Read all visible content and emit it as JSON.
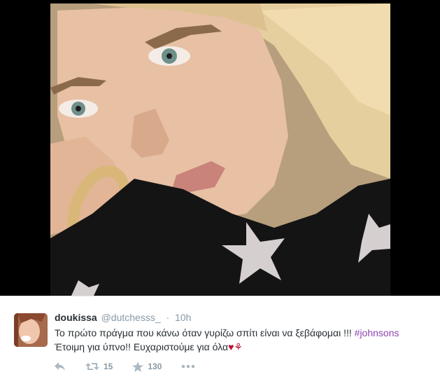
{
  "tweet": {
    "fullname": "doukissa",
    "username": "@dutchesss_",
    "separator": "·",
    "time": "10h",
    "text_line1": "Το πρώτο πράγμα που κάνω όταν γυρίζω σπίτι είναι να ξεβάφομαι !!! ",
    "hashtag": "#johnsons",
    "text_line2": "Έτοιμη για ύπνο!! Ευχαριστούμε για όλα",
    "heart_glyph": "♥",
    "flower_glyph": "⚘"
  },
  "actions": {
    "reply_icon": "reply-icon",
    "retweet_icon": "retweet-icon",
    "retweet_count": "15",
    "favorite_icon": "star-icon",
    "favorite_count": "130",
    "more_icon": "more-icon"
  },
  "colors": {
    "hashtag": "#8e44ad",
    "muted": "#8899a6",
    "text": "#292f33",
    "heart": "#c0102e"
  }
}
